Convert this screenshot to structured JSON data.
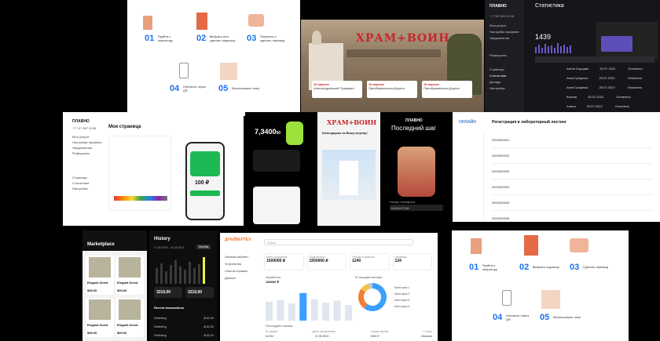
{
  "tile_onboarding": {
    "steps": [
      {
        "num": "01",
        "label": "Прийти к оператору"
      },
      {
        "num": "02",
        "label": "Выбрать или сделать подписку"
      },
      {
        "num": "03",
        "label": "Получить и сделать перевод"
      },
      {
        "num": "04",
        "label": "Оплатить через QR"
      },
      {
        "num": "05",
        "label": "Использовать чеки"
      }
    ]
  },
  "tile_hram": {
    "logo": "ХРАМ+ВОИН",
    "cards": [
      {
        "date": "16 апреля",
        "title": "Александровский Трафарет"
      },
      {
        "date": "16 апреля",
        "title": "Преображенская Дорога"
      },
      {
        "date": "16 апреля",
        "title": "Преображенская Дорога"
      }
    ]
  },
  "tile_stats": {
    "brand": "ПЛАВНО",
    "phone": "+7 702 961 09 28",
    "title": "Статистика",
    "menu": [
      "Мои услуги",
      "Настройки профиля",
      "Уведомления",
      "Реферрилы",
      "Страницы",
      "Статистика",
      "Доходы",
      "Настройки"
    ],
    "total": "1439",
    "rows": [
      {
        "name": "Антон Бородин",
        "date": "25.07.2022",
        "status": "Оплачено"
      },
      {
        "name": "Анна Гриценко",
        "date": "25.07.2022",
        "status": "Оплачено"
      },
      {
        "name": "Анна Гриценко",
        "date": "25.07.2022",
        "status": "Оплачено"
      },
      {
        "name": "Ксения",
        "date": "25.07.2022",
        "status": "Оплачено"
      },
      {
        "name": "Алина",
        "date": "25.07.2022",
        "status": "Оплачено"
      }
    ]
  },
  "tile_mypage": {
    "brand": "ПЛАВНО",
    "phone": "+7 747 897 5158",
    "title": "Моя страница",
    "menu": [
      "Мои услуги",
      "Настройки профиля",
      "Уведомления",
      "Реферрилы",
      "Страницы",
      "Статистика",
      "Настройки"
    ],
    "price": "100 ₽"
  },
  "tile_finance": {
    "balance": "7,3400",
    "unit": "00"
  },
  "tile_phone_hram": {
    "logo": "ХРАМ+ВОИН",
    "caption": "Благодарим за Вашу жертву!"
  },
  "tile_last_step": {
    "brand": "ПЛАВНО",
    "title": "Последний шаг",
    "field_label": "Номер телефона",
    "field_value": "КАЗАХСТАН"
  },
  "tile_lab": {
    "brand": "ОНЛАЙН",
    "title": "Регистрация в лабораторный листинг",
    "rows": [
      "0000000001",
      "0000000002",
      "0000000003",
      "0000000004",
      "0000000005",
      "0000000006"
    ]
  },
  "tile_market": {
    "title": "Marketplace",
    "items": [
      {
        "name": "Elegant Scent",
        "price": "$99.00"
      },
      {
        "name": "Elegant Scent",
        "price": "$99.00"
      },
      {
        "name": "Elegant Scent",
        "price": "$99.00"
      },
      {
        "name": "Elegant Scent",
        "price": "$99.00"
      }
    ]
  },
  "tile_history": {
    "title": "History",
    "range": "01.08.2023 - 31.08.2023",
    "period": "Monthly",
    "left_val": "3210,00",
    "right_val": "3210,00",
    "recent": "Recent transactions",
    "tx": [
      {
        "name": "Dribbling",
        "amt": "-$15,00"
      },
      {
        "name": "Dribbling",
        "amt": "-$15,00"
      },
      {
        "name": "Dribbling",
        "amt": "-$15,00"
      }
    ]
  },
  "tile_dashboard": {
    "logo": "ДРАЙВЕРТЕХ",
    "search_placeholder": "Поиск",
    "menu": [
      "Личный кабинет",
      "Устройства",
      "Список справок",
      "Данные"
    ],
    "stats": [
      {
        "label": "Всего устройств",
        "value": "1500000 ₽"
      },
      {
        "label": "Подключено",
        "value": "1500000 ₽"
      },
      {
        "label": "Общая стоимость",
        "value": "1240"
      },
      {
        "label": "Активных",
        "value": "124"
      }
    ],
    "chart_title": "Заработок",
    "chart_total": "150000 ₽",
    "donut_title": "В текущем месяце",
    "legend": [
      "Категория 1",
      "Категория 2",
      "Категория 3",
      "Категория 4"
    ],
    "table_title": "Последние заказы",
    "table_headers": [
      "ID заказа",
      "Дата оформления",
      "Сумма заказа",
      "Статус"
    ],
    "table_row": [
      "#1234",
      "11.08.2023",
      "1500 ₽",
      "Оплачен"
    ],
    "chart_data": {
      "type": "bar",
      "categories": [
        "1",
        "2",
        "3",
        "4",
        "5",
        "6",
        "7",
        "8"
      ],
      "values": [
        55,
        60,
        50,
        80,
        62,
        52,
        58,
        45
      ],
      "highlight_index": 3
    },
    "donut_data": {
      "type": "pie",
      "values": [
        60,
        25,
        10,
        5
      ],
      "colors": [
        "#3aa0ff",
        "#f57c36",
        "#f4c542",
        "#bfc6d2"
      ]
    }
  },
  "tile_onboarding2": {
    "steps": [
      {
        "num": "01",
        "label": "Прийти к оператору"
      },
      {
        "num": "02",
        "label": "Выбрать подписку"
      },
      {
        "num": "03",
        "label": "Сделать перевод"
      },
      {
        "num": "04",
        "label": "Оплатить через QR"
      },
      {
        "num": "05",
        "label": "Использовать чеки"
      }
    ]
  }
}
